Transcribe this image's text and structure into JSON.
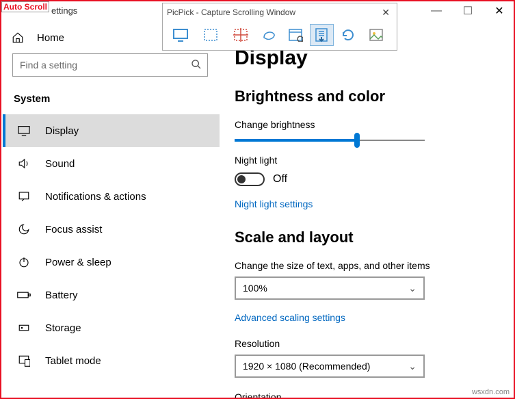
{
  "autoscroll_label": "Auto Scroll",
  "window_title_fragment": "ettings",
  "picpick": {
    "title": "PicPick - Capture Scrolling Window",
    "close": "✕"
  },
  "sysbtns": {
    "min": "—",
    "max": "☐",
    "close": "✕"
  },
  "home_label": "Home",
  "search_placeholder": "Find a setting",
  "section_label": "System",
  "nav": [
    {
      "label": "Display"
    },
    {
      "label": "Sound"
    },
    {
      "label": "Notifications & actions"
    },
    {
      "label": "Focus assist"
    },
    {
      "label": "Power & sleep"
    },
    {
      "label": "Battery"
    },
    {
      "label": "Storage"
    },
    {
      "label": "Tablet mode"
    }
  ],
  "page": {
    "heading": "Display",
    "sec1": "Brightness and color",
    "brightness_label": "Change brightness",
    "brightness_percent": 63,
    "nightlight_label": "Night light",
    "nightlight_state": "Off",
    "nightlight_link": "Night light settings",
    "sec2": "Scale and layout",
    "scale_label": "Change the size of text, apps, and other items",
    "scale_value": "100%",
    "scale_link": "Advanced scaling settings",
    "resolution_label": "Resolution",
    "resolution_value": "1920 × 1080 (Recommended)",
    "orientation_label": "Orientation"
  },
  "watermark": "wsxdn.com",
  "colors": {
    "accent": "#0078d4",
    "link": "#0067c0",
    "frame": "#e81123"
  }
}
